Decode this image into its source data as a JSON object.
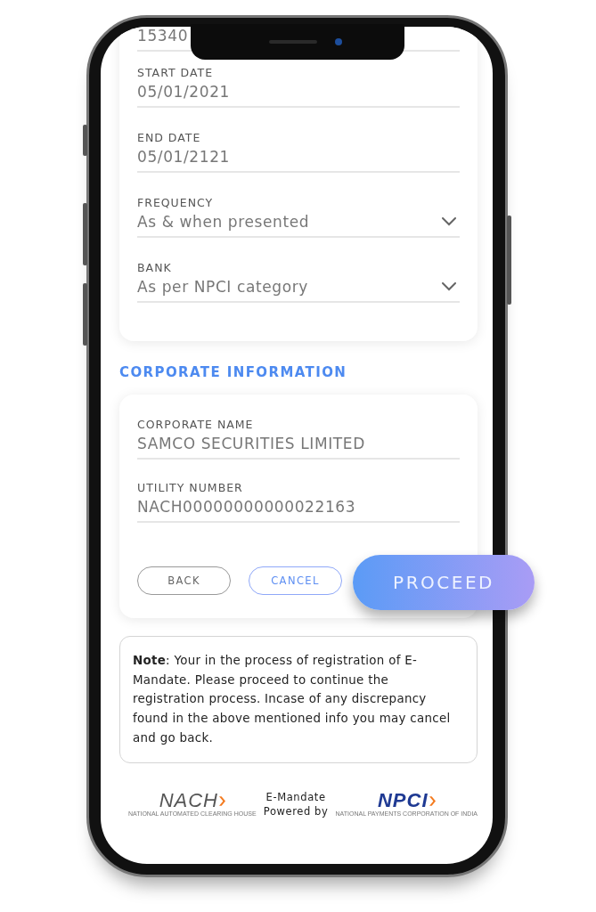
{
  "mandate_card": {
    "fields": [
      {
        "kind": "text",
        "value": "15340"
      },
      {
        "kind": "text",
        "label": "START DATE",
        "value": "05/01/2021"
      },
      {
        "kind": "text",
        "label": "END DATE",
        "value": "05/01/2121"
      },
      {
        "kind": "select",
        "label": "FREQUENCY",
        "value": "As & when presented"
      },
      {
        "kind": "select",
        "label": "BANK",
        "value": "As per NPCI category"
      }
    ]
  },
  "corporate_section": {
    "heading": "CORPORATE INFORMATION",
    "fields": [
      {
        "kind": "text",
        "label": "CORPORATE NAME",
        "value": "SAMCO SECURITIES LIMITED"
      },
      {
        "kind": "text",
        "label": "UTILITY NUMBER",
        "value": "NACH00000000000022163"
      }
    ],
    "buttons": [
      {
        "kind": "outline",
        "label": "BACK"
      },
      {
        "kind": "accent",
        "label": "CANCEL"
      },
      {
        "kind": "primary",
        "label": "PROCEED"
      }
    ]
  },
  "note": {
    "text": "**Note**: Your in the process of registration of E-Mandate. Please proceed to continue the registration process. Incase of any discrepancy found in the above mentioned info you may cancel and go back."
  },
  "footer": {
    "left_logo": {
      "name": "NACH",
      "caption": "NATIONAL AUTOMATED CLEARING HOUSE"
    },
    "center_lines": [
      "E-Mandate",
      "Powered by"
    ],
    "right_logo": {
      "name": "NPCI",
      "caption": "NATIONAL PAYMENTS CORPORATION OF INDIA"
    }
  }
}
